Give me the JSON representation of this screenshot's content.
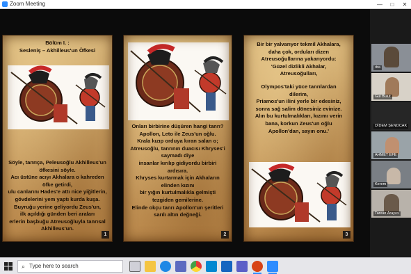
{
  "window": {
    "title": "Zoom Meeting",
    "minimize": "—",
    "maximize": "□",
    "close": "✕"
  },
  "slides": [
    {
      "heading_line1": "Bölüm I. :",
      "heading_line2": "Sesleniş – Akhilleus'un Öfkesi",
      "body": [
        "Söyle, tanrıça, Peleusoğlu Akhilleus'un",
        "öfkesini söyle.",
        "Acı üstüne acıyı Akhalara o kahreden",
        "öfke getirdi,",
        "ulu canlarını Hades'e attı nice yiğitlerin,",
        "gövdelerini yem yaptı kurda kuşa.",
        "Buyruğu yerine geliyordu Zeus'un,",
        "ilk açıldığı günden beri araları",
        "erlerin başbuğu Atreusoğluyla tanrısal",
        "Akhilleus'un."
      ],
      "number": "1"
    },
    {
      "body": [
        "Onları birbirine düşüren hangi tanrı?",
        "Apollon, Leto ile Zeus'un oğlu.",
        "Krala kızıp orduya kıran salan o;",
        "Atreusoğlu, tanrının duacısı Khryses'i",
        "saymadı diye",
        "insanlar kırılıp gidiyordu birbiri",
        "ardısıra.",
        "Khryses kurtarmak için Akhaların",
        "elinden kızını",
        "bir yığın kurtulmalıkla gelmişti",
        "tezgiden gemilerine.",
        "Elinde okçu tanrı Apollon'un şeritleri",
        "sarılı altın değneği."
      ],
      "number": "2"
    },
    {
      "body": [
        "Bir bir yalvarıyor tekmil Akhalara,",
        "daha çok, orduları dizen",
        "Atreusoğullarına yakarıyordu:",
        "'Güzel dizlikli Akhalar,",
        "Atreusoğulları,",
        "",
        "Olympos'taki yüce tanrılardan",
        "dilerim,",
        "Priamos'un ilini yerle bir edesiniz,",
        "sonra sağ salim dönesiniz evinize.",
        "Alın bu kurtulmalıkları, kızımı verin",
        "bana, korkun Zeus'un oğlu",
        "Apollon'dan, sayın onu.'"
      ],
      "number": "3"
    }
  ],
  "participants": [
    {
      "name": "ıtra"
    },
    {
      "name": "Gül Bulut"
    },
    {
      "name": "DİDEM ŞENOCAK"
    },
    {
      "name": "AHMET EFE"
    },
    {
      "name": "Kerem"
    },
    {
      "name": "Tanver Arayıcı"
    }
  ],
  "taskbar": {
    "search_placeholder": "Type here to search",
    "apps": [
      "task-view",
      "file-explorer",
      "edge",
      "store",
      "chrome",
      "mail",
      "outlook",
      "teams",
      "powerpoint",
      "zoom"
    ]
  },
  "colors": {
    "parchment": "#caa063",
    "zoom_blue": "#2d8cff",
    "taskbar": "#e6e6ea"
  }
}
